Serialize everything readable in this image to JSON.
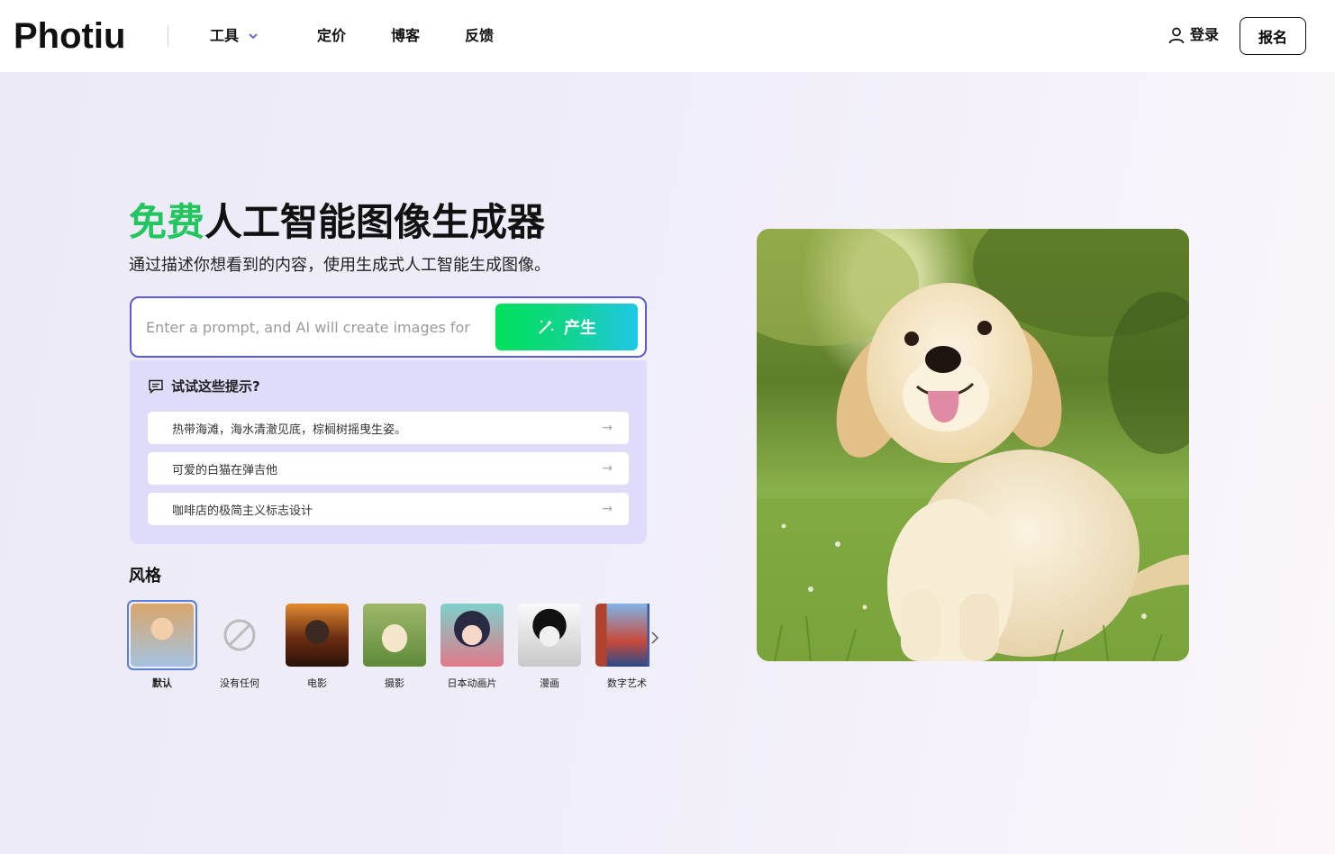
{
  "header": {
    "logo": "Photiu",
    "nav": {
      "tools": "工具",
      "pricing": "定价",
      "blog": "博客",
      "feedback": "反馈"
    },
    "login": "登录",
    "signup": "报名"
  },
  "hero": {
    "title_accent": "免费",
    "title_rest": "人工智能图像生成器",
    "subtitle": "通过描述你想看到的内容，使用生成式人工智能生成图像。",
    "prompt_placeholder": "Enter a prompt, and AI will create images for",
    "generate_label": "产生"
  },
  "suggestions": {
    "heading": "试试这些提示?",
    "items": [
      "热带海滩，海水清澈见底，棕榈树摇曳生姿。",
      "可爱的白猫在弹吉他",
      "咖啡店的极简主义标志设计"
    ]
  },
  "styles": {
    "heading": "风格",
    "items": [
      {
        "label": "默认",
        "selected": true
      },
      {
        "label": "没有任何"
      },
      {
        "label": "电影"
      },
      {
        "label": "摄影"
      },
      {
        "label": "日本动画片"
      },
      {
        "label": "漫画"
      },
      {
        "label": "数字艺术"
      }
    ]
  },
  "colors": {
    "accent_green": "#22c55e",
    "prompt_border": "#5b5bd6",
    "panel_bg": "#dedcfa"
  }
}
